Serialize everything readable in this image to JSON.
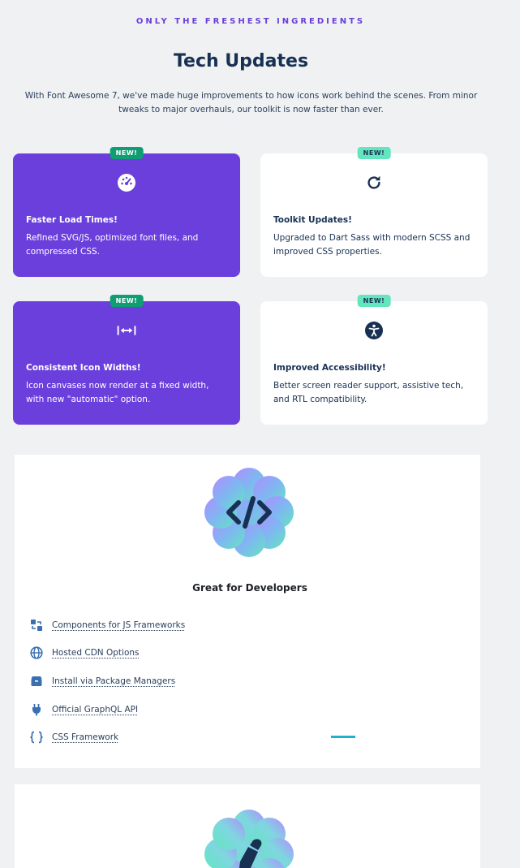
{
  "header": {
    "eyebrow": "ONLY THE FRESHEST INGREDIENTS",
    "title": "Tech Updates",
    "intro": "With Font Awesome 7, we've made huge improvements to how icons work behind the scenes. From minor tweaks to major overhauls, our toolkit is now faster than ever."
  },
  "cards": [
    {
      "badge": "NEW!",
      "icon": "gauge-icon",
      "title": "Faster Load Times!",
      "text": "Refined SVG/JS, optimized font files, and compressed CSS."
    },
    {
      "badge": "NEW!",
      "icon": "rotate-right-icon",
      "title": "Toolkit Updates!",
      "text": "Upgraded to Dart Sass with modern SCSS and improved CSS properties."
    },
    {
      "badge": "NEW!",
      "icon": "arrows-left-right-to-line-icon",
      "title": "Consistent Icon Widths!",
      "text": "Icon canvases now render at a fixed width, with new \"automatic\" option."
    },
    {
      "badge": "NEW!",
      "icon": "universal-access-icon",
      "title": "Improved Accessibility!",
      "text": "Better screen reader support, assistive tech, and RTL compatibility."
    }
  ],
  "developers": {
    "icon": "code-icon",
    "title": "Great for Developers",
    "links": [
      {
        "icon": "js-frameworks-icon",
        "label": "Components for JS Frameworks"
      },
      {
        "icon": "globe-icon",
        "label": "Hosted CDN Options"
      },
      {
        "icon": "box-icon",
        "label": "Install via Package Managers"
      },
      {
        "icon": "plug-icon",
        "label": "Official GraphQL API"
      },
      {
        "icon": "brackets-curly-icon",
        "label": "CSS Framework"
      }
    ]
  },
  "colors": {
    "purple": "#6b3fdb",
    "navy": "#183153",
    "badge_dark": "#0f9d72",
    "badge_light": "#63e6be"
  }
}
